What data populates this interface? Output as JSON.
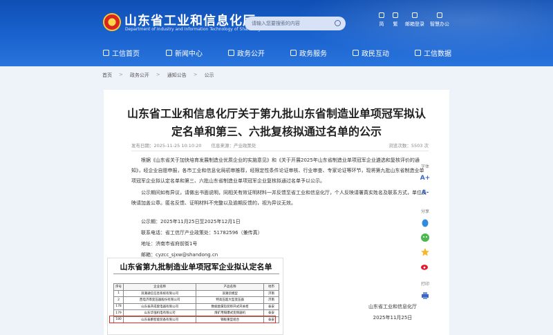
{
  "header": {
    "site_name": "山东省工业和信息化厅",
    "site_sub": "Department of Industry and Information Technology of Shandong Province",
    "search_placeholder": "请输入您要搜索的内容",
    "tools": [
      {
        "label": "简",
        "icon": "simplified-icon"
      },
      {
        "label": "繁",
        "icon": "traditional-icon"
      },
      {
        "label": "邮箱登录",
        "icon": "mail-icon"
      },
      {
        "label": "智慧办公",
        "icon": "office-icon"
      }
    ]
  },
  "nav": [
    {
      "label": "工信首页",
      "icon": "home-icon"
    },
    {
      "label": "新闻中心",
      "icon": "news-icon"
    },
    {
      "label": "政务公开",
      "icon": "gov-icon"
    },
    {
      "label": "政务服务",
      "icon": "service-icon"
    },
    {
      "label": "政民互动",
      "icon": "interact-icon"
    },
    {
      "label": "工信数据",
      "icon": "data-icon"
    }
  ],
  "breadcrumb": [
    "首页",
    "政务公开",
    "通知公告",
    "公示"
  ],
  "article": {
    "title": "山东省工业和信息化厅关于第九批山东省制造业单项冠军拟认定名单和第三、六批复核拟通过名单的公示",
    "date": "发布日期：2025-11-25 10:10:20",
    "source": "信息来源：产业政策处",
    "views": "浏览次数：5503 次",
    "para1": "根据《山东省关于加快培育发展制造业优质企业的实施意见》和《关于开展2025年山东省制造业单项冠军企业遴选和复核评价的通知》，经企业自愿申报，各市工业和信息化局初审推荐，经限定性条件论证审核、行业审查、专家论证等环节，现将第九批山东省制造业单项冠军企业拟认定名单和第三、六批山东省制造业单项冠军企业复核拟通过名单予以公示。",
    "para2": "公示期间如有异议，请做出书面说明，同相关有效证明材料一并反馈至省工业和信息化厅，个人反映请署真实姓名及联系方式，单位反映请加盖公章。匿名反馈、证明材料不完整以及逾期反馈的，视为异议无效。",
    "period": "公示期：2025年11月25日至2025年12月1日",
    "phone": "联系电话：省工信厅产业政策处：51782596（兼传真）",
    "address": "地址：济南市省府前街1号",
    "email": "邮箱：cyzcc_sjxw@shandong.cn",
    "sign_org": "山东省工业和信息化厅",
    "sign_date": "2025年11月25日"
  },
  "table_image": {
    "title": "山东省第九批制造业单项冠军企业拟认定名单",
    "headers": [
      "序号",
      "企业名称",
      "产品名称",
      "地市"
    ],
    "rows": [
      [
        "1",
        "浪潮通信信息系统有限公司",
        "浪潮云模型",
        "济南"
      ],
      [
        "2",
        "西电济南变压器股份有限公司",
        "特高压超大型变压器",
        "济南"
      ],
      [
        "178",
        "山东泰开成套电器有限公司",
        "数据金属铠装移开式开关柜",
        "泰安"
      ],
      [
        "179",
        "山东华强机电有限公司",
        "煤矿用隔爆式变频器机",
        "泰安"
      ],
      [
        "180",
        "山东泰鹏智能装备有限公司",
        "钢板重型组合",
        "泰安"
      ]
    ]
  },
  "side": {
    "font_label": "字体",
    "font_up": "A+",
    "font_down": "A-",
    "share_label": "分享",
    "print_label": "打印"
  }
}
